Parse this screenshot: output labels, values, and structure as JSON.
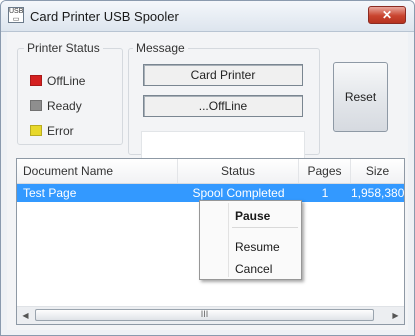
{
  "window": {
    "title": "Card Printer USB Spooler",
    "close_label": "✕"
  },
  "printer_status": {
    "label": "Printer Status",
    "items": [
      {
        "label": "OffLine",
        "color": "#d42020"
      },
      {
        "label": "Ready",
        "color": "#8e8e8e"
      },
      {
        "label": "Error",
        "color": "#e8d82a"
      }
    ]
  },
  "message": {
    "label": "Message",
    "line1": "Card Printer",
    "line2": "...OffLine"
  },
  "reset_label": "Reset",
  "table": {
    "columns": [
      "Document Name",
      "Status",
      "Pages",
      "Size"
    ],
    "rows": [
      {
        "name": "Test Page",
        "status": "Spool Completed",
        "pages": "1",
        "size": "1,958,380"
      }
    ]
  },
  "context_menu": {
    "items": [
      "Pause",
      "Resume",
      "Cancel"
    ]
  },
  "scrollbar": {
    "grip": "III"
  }
}
